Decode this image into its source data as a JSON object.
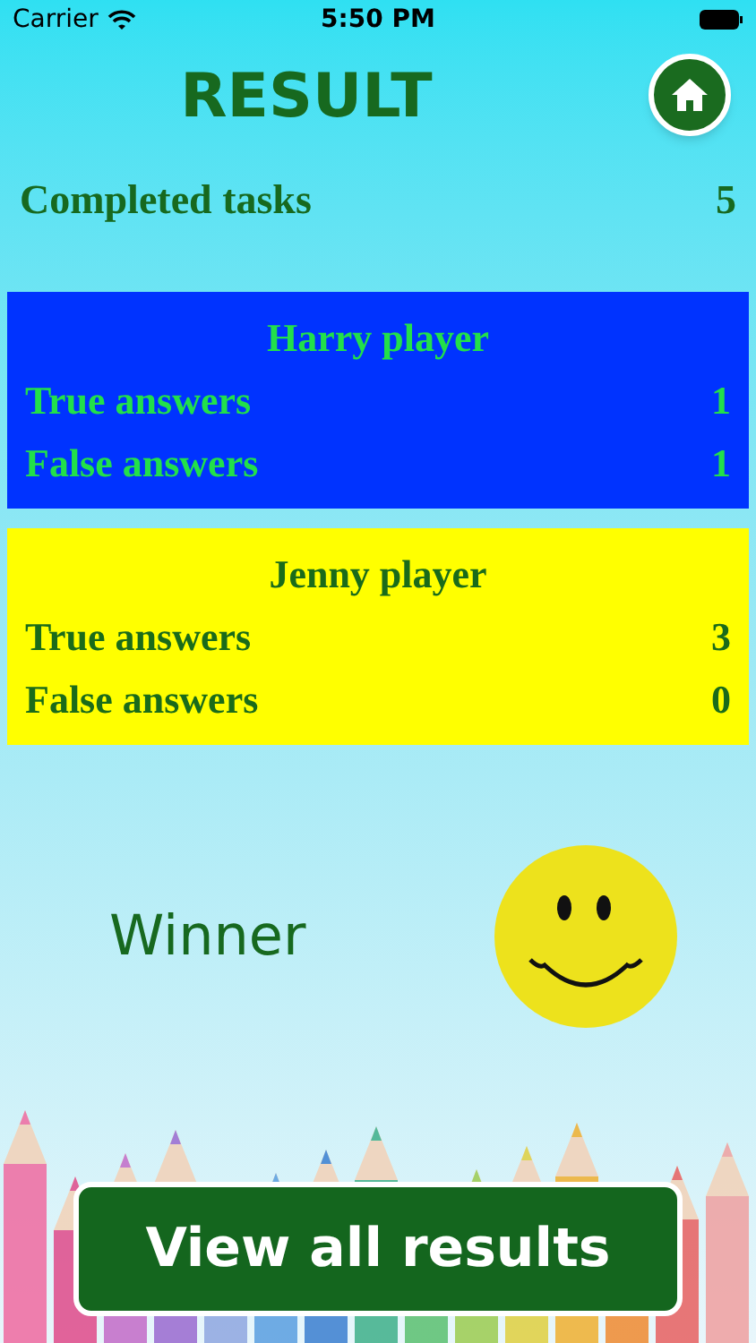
{
  "status_bar": {
    "carrier": "Carrier",
    "time": "5:50 PM"
  },
  "title": "RESULT",
  "completed": {
    "label": "Completed tasks",
    "value": "5"
  },
  "players": [
    {
      "name": "Harry player",
      "color": "#0033ff",
      "kind": "dark",
      "rows": [
        {
          "label": "True answers",
          "value": "1"
        },
        {
          "label": "False answers",
          "value": "1"
        }
      ]
    },
    {
      "name": "Jenny player",
      "color": "#ffff00",
      "kind": "light",
      "rows": [
        {
          "label": "True answers",
          "value": "3"
        },
        {
          "label": "False answers",
          "value": "0"
        }
      ]
    }
  ],
  "winner": {
    "label": "Winner"
  },
  "button": "View all results"
}
